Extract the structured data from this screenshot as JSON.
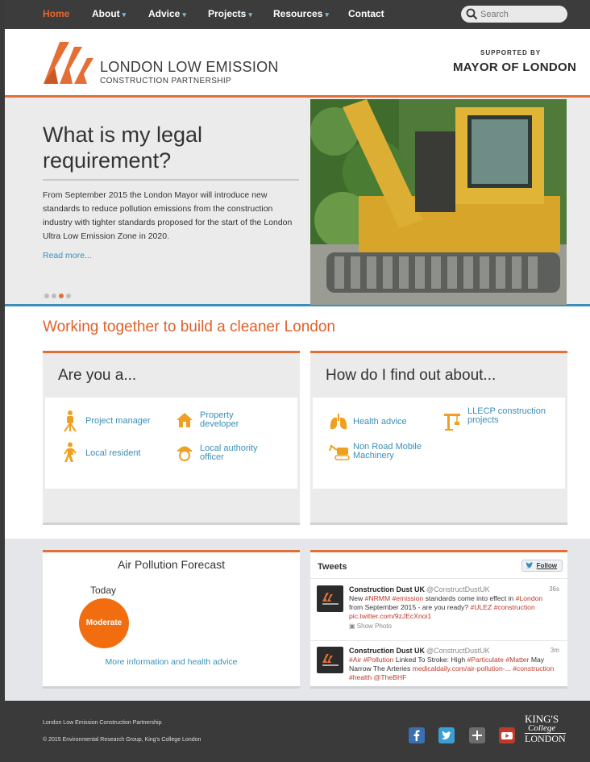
{
  "nav": {
    "items": [
      {
        "label": "Home"
      },
      {
        "label": "About"
      },
      {
        "label": "Advice"
      },
      {
        "label": "Projects"
      },
      {
        "label": "Resources"
      },
      {
        "label": "Contact"
      }
    ],
    "search_placeholder": "Search"
  },
  "header": {
    "brand_title": "LONDON LOW EMISSION",
    "brand_subtitle": "CONSTRUCTION PARTNERSHIP",
    "supported_by": "SUPPORTED BY",
    "mayor": "MAYOR OF LONDON"
  },
  "hero": {
    "title": "What is my legal requirement?",
    "text": "From September 2015 the London Mayor will introduce new standards to reduce pollution emissions from the construction industry with tighter standards proposed for the start of the London Ultra Low Emission Zone in 2020.",
    "read_more": "Read more...",
    "slides": 4,
    "active_slide": 3
  },
  "section_heading": "Working together to build a cleaner London",
  "are_you": {
    "title": "Are you a...",
    "items": [
      {
        "label": "Project manager",
        "icon": "surveyor-icon"
      },
      {
        "label": "Property developer",
        "icon": "house-icon"
      },
      {
        "label": "Local resident",
        "icon": "walking-person-icon"
      },
      {
        "label": "Local authority officer",
        "icon": "hardhat-worker-icon"
      }
    ]
  },
  "find_out": {
    "title": "How do I find out about...",
    "items": [
      {
        "label": "Health advice",
        "icon": "lungs-icon"
      },
      {
        "label": "LLECP construction projects",
        "icon": "crane-icon"
      },
      {
        "label": "Non Road Mobile Machinery",
        "icon": "machinery-icon"
      }
    ]
  },
  "forecast": {
    "title": "Air Pollution Forecast",
    "day": "Today",
    "level": "Moderate",
    "more_link": "More information and health advice"
  },
  "tweets": {
    "title": "Tweets",
    "follow": "Follow",
    "items": [
      {
        "name": "Construction Dust UK",
        "handle": "@ConstructDustUK",
        "time": "36s",
        "text_parts": [
          "New ",
          "#NRMM",
          " ",
          "#emission",
          " standards come into effect in ",
          "#London",
          " from September 2015 - are you ready? ",
          "#ULEZ",
          " ",
          "#construction",
          " pic.twitter.com/9zJEcXnoi1"
        ],
        "photo": "Show Photo"
      },
      {
        "name": "Construction Dust UK",
        "handle": "@ConstructDustUK",
        "time": "3m",
        "text_parts": [
          "#Air",
          " ",
          "#Pollution",
          " Linked To Stroke: High ",
          "#Particulate",
          " ",
          "#Matter",
          " May Narrow The Arteries ",
          "medicaldaily.com/air-pollution-...",
          " ",
          "#construction",
          " ",
          "#health",
          " ",
          "@TheBHF"
        ]
      }
    ]
  },
  "footer": {
    "line1": "London Low Emission Construction Partnership",
    "line2": "© 2015 Environmental Research Group, King's College London",
    "logo_lines": [
      "KING'S",
      "College",
      "LONDON"
    ],
    "social": [
      "facebook-icon",
      "twitter-icon",
      "google-plus-icon",
      "youtube-icon"
    ]
  },
  "colors": {
    "accent": "#e36f37",
    "link": "#3a8fb7",
    "forecast_moderate": "#f26d0f",
    "dark": "#3c3c3c"
  }
}
